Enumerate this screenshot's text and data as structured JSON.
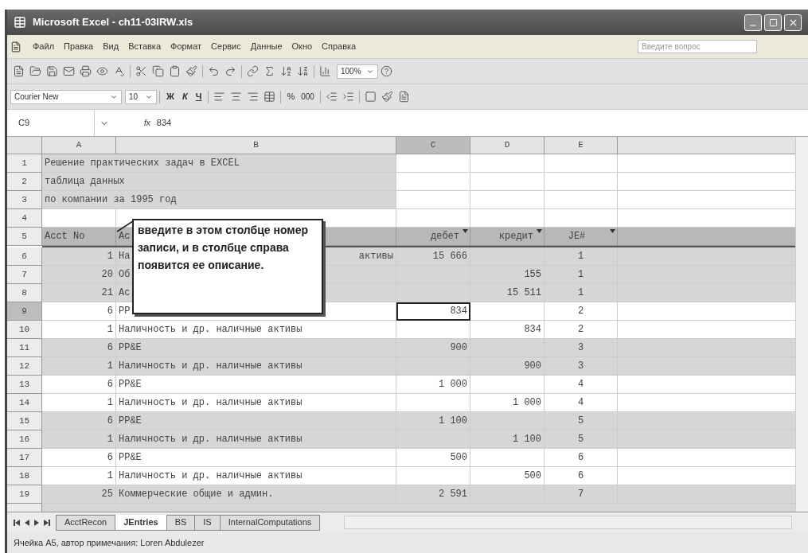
{
  "window": {
    "title": "Microsoft Excel - ch11-03IRW.xls"
  },
  "menu": [
    "Файл",
    "Правка",
    "Вид",
    "Вставка",
    "Формат",
    "Сервис",
    "Данные",
    "Окно",
    "Справка"
  ],
  "help_field": {
    "placeholder": "Введите вопрос"
  },
  "standard_toolbar": {
    "zoom": "100%"
  },
  "formatting_toolbar": {
    "font": "Courier New",
    "size": "10",
    "style_buttons": [
      "Ж",
      "К",
      "Ч"
    ],
    "percent": "%",
    "thousands": "000"
  },
  "formula_bar": {
    "name_box": "C9",
    "fx": "fx",
    "value": "834"
  },
  "columns": [
    {
      "label": "A",
      "selected": false
    },
    {
      "label": "B",
      "selected": false
    },
    {
      "label": "C",
      "selected": true
    },
    {
      "label": "D",
      "selected": false
    },
    {
      "label": "E",
      "selected": false
    }
  ],
  "rows": [
    {
      "number": "1",
      "selected": false,
      "shaded": true,
      "kind": "title",
      "title": "Решение практических задач в EXCEL"
    },
    {
      "number": "2",
      "selected": false,
      "shaded": true,
      "kind": "title",
      "title": "таблица данных"
    },
    {
      "number": "3",
      "selected": false,
      "shaded": true,
      "kind": "title",
      "title": "по компании за 1995 год"
    },
    {
      "number": "4",
      "selected": false,
      "shaded": false,
      "kind": "empty"
    },
    {
      "number": "5",
      "selected": false,
      "shaded": true,
      "kind": "header",
      "labels": [
        "Acct No",
        "Ac",
        "дебет",
        "кредит",
        "JE#"
      ]
    },
    {
      "number": "6",
      "selected": false,
      "shaded": true,
      "kind": "data",
      "acct": "1",
      "account": "На",
      "account_tail": "активы",
      "debit": "15 666",
      "credit": "",
      "je": "1"
    },
    {
      "number": "7",
      "selected": false,
      "shaded": true,
      "kind": "data",
      "acct": "20",
      "account": "Об",
      "debit": "",
      "credit": "155",
      "je": "1"
    },
    {
      "number": "8",
      "selected": false,
      "shaded": true,
      "kind": "data",
      "acct": "21",
      "account": "Ac",
      "debit": "",
      "credit": "15 511",
      "je": "1"
    },
    {
      "number": "9",
      "selected": true,
      "shaded": false,
      "kind": "data",
      "acct": "6",
      "account": "PP",
      "debit": "834",
      "debit_selected": true,
      "credit": "",
      "je": "2"
    },
    {
      "number": "10",
      "selected": false,
      "shaded": false,
      "kind": "data",
      "acct": "1",
      "account": "Наличность и др. наличные активы",
      "debit": "",
      "credit": "834",
      "je": "2"
    },
    {
      "number": "11",
      "selected": false,
      "shaded": true,
      "kind": "data",
      "acct": "6",
      "account": "PP&E",
      "debit": "900",
      "credit": "",
      "je": "3"
    },
    {
      "number": "12",
      "selected": false,
      "shaded": true,
      "kind": "data",
      "acct": "1",
      "account": "Наличность и др. наличные активы",
      "debit": "",
      "credit": "900",
      "je": "3"
    },
    {
      "number": "13",
      "selected": false,
      "shaded": false,
      "kind": "data",
      "acct": "6",
      "account": "PP&E",
      "debit": "1 000",
      "credit": "",
      "je": "4"
    },
    {
      "number": "14",
      "selected": false,
      "shaded": false,
      "kind": "data",
      "acct": "1",
      "account": "Наличность и др. наличные активы",
      "debit": "",
      "credit": "1 000",
      "je": "4"
    },
    {
      "number": "15",
      "selected": false,
      "shaded": true,
      "kind": "data",
      "acct": "6",
      "account": "PP&E",
      "debit": "1 100",
      "credit": "",
      "je": "5"
    },
    {
      "number": "16",
      "selected": false,
      "shaded": true,
      "kind": "data",
      "acct": "1",
      "account": "Наличность и др. наличные активы",
      "debit": "",
      "credit": "1 100",
      "je": "5"
    },
    {
      "number": "17",
      "selected": false,
      "shaded": false,
      "kind": "data",
      "acct": "6",
      "account": "PP&E",
      "debit": "500",
      "credit": "",
      "je": "6"
    },
    {
      "number": "18",
      "selected": false,
      "shaded": false,
      "kind": "data",
      "acct": "1",
      "account": "Наличность и др. наличные активы",
      "debit": "",
      "credit": "500",
      "je": "6"
    },
    {
      "number": "19",
      "selected": false,
      "shaded": true,
      "kind": "data",
      "acct": "25",
      "account": "Коммерческие общие и админ.",
      "debit": "2 591",
      "credit": "",
      "je": "7"
    }
  ],
  "comment": {
    "text": "введите в этом столбце номер записи, и в столбце справа появится ее описание."
  },
  "sheet_tabs": [
    {
      "label": "AcctRecon",
      "selected": false
    },
    {
      "label": "JEntries",
      "selected": true
    },
    {
      "label": "BS",
      "selected": false
    },
    {
      "label": "IS",
      "selected": false
    },
    {
      "label": "InternalComputations",
      "selected": false
    }
  ],
  "status_bar": "Ячейка A5, автор примечания: Loren Abdulezer"
}
